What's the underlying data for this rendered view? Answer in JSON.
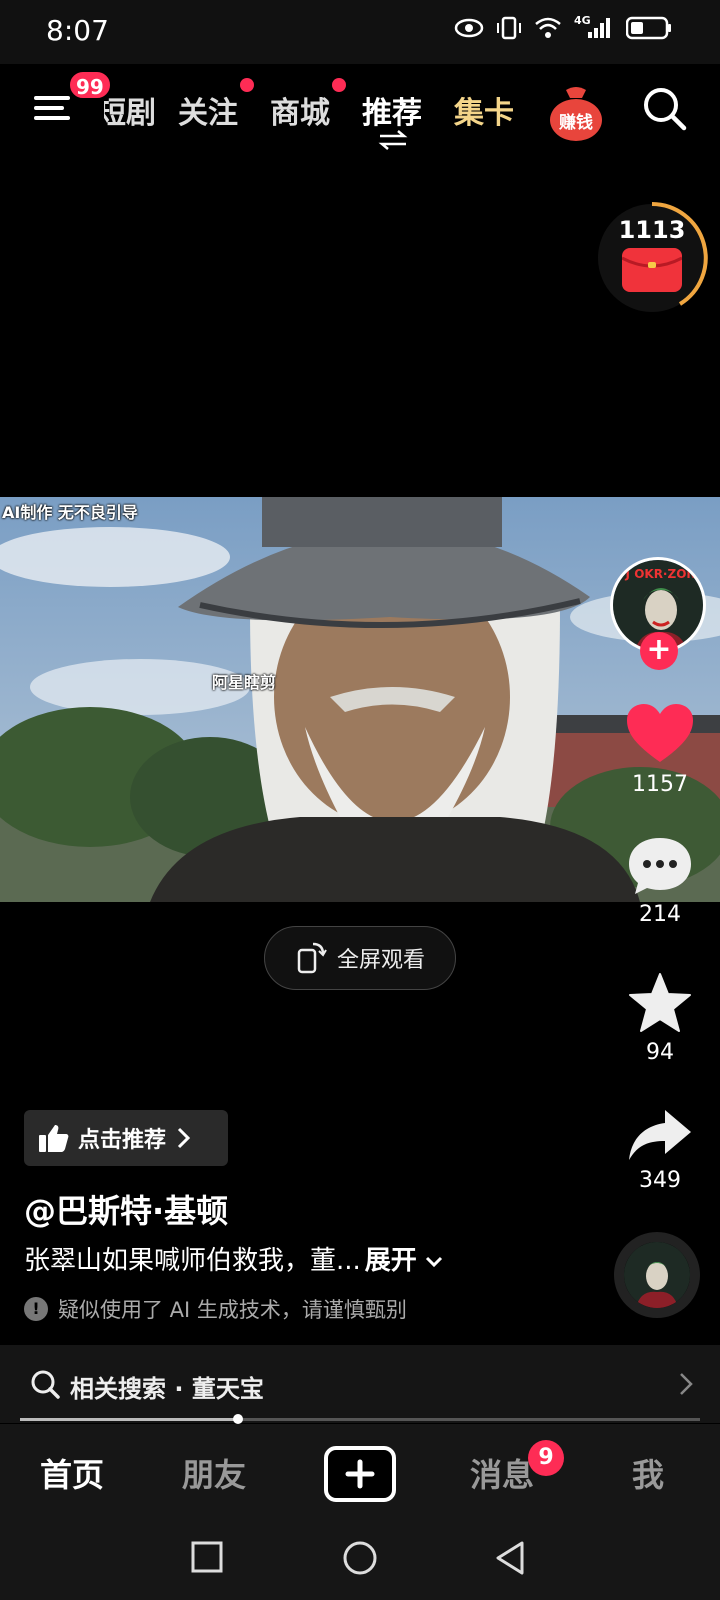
{
  "status_bar": {
    "time": "8:07",
    "network": "4G"
  },
  "top_nav": {
    "menu_badge": "99",
    "tabs": [
      {
        "label": "短剧",
        "state": "partially-covered"
      },
      {
        "label": "关注",
        "dot": true
      },
      {
        "label": "商城",
        "dot": true
      },
      {
        "label": "推荐",
        "active": true
      },
      {
        "label": "集卡",
        "style": "gold"
      }
    ],
    "earn_label": "赚钱"
  },
  "red_packet": {
    "count": "1113"
  },
  "video": {
    "ai_notice": "AI制作  无不良引导",
    "watermark": "阿星瞎剪",
    "fullscreen_label": "全屏观看"
  },
  "actions": {
    "likes": "1157",
    "comments": "214",
    "favorites": "94",
    "shares": "349"
  },
  "info": {
    "recommend_label": "点击推荐",
    "author": "@巴斯特·基顿",
    "caption": "张翠山如果喊师伯救我，董...",
    "expand_label": "展开",
    "ai_warning": "疑似使用了 AI 生成技术，请谨慎甄别",
    "related_search": "相关搜索 · 董天宝"
  },
  "playback": {
    "progress": 0.32
  },
  "tabbar": {
    "home": "首页",
    "friends": "朋友",
    "messages": "消息",
    "messages_badge": "9",
    "me": "我"
  },
  "colors": {
    "accent": "#fe2c55",
    "gold": "#f4d58a",
    "background": "#000000"
  },
  "icons": [
    "menu-icon",
    "search-icon",
    "switch-icon",
    "red-packet-icon",
    "heart-icon",
    "comment-icon",
    "star-icon",
    "share-icon",
    "thumbs-up-icon",
    "chevron-right-icon",
    "chevron-down-icon",
    "phone-rotate-icon",
    "plus-icon",
    "square-icon",
    "circle-icon",
    "back-triangle-icon"
  ]
}
